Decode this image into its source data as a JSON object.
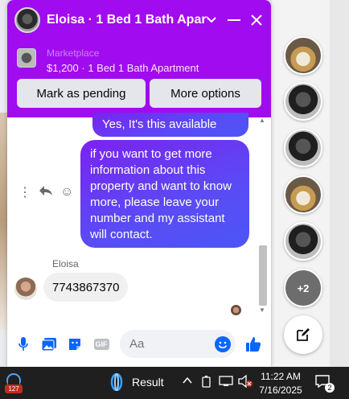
{
  "chat": {
    "title": "Eloisa · 1 Bed 1 Bath Apart",
    "marketplace_label": "Marketplace",
    "listing_title": "$1,200 · 1 Bed 1 Bath Apartment",
    "mark_pending_label": "Mark as pending",
    "more_options_label": "More options",
    "icons": {
      "chevron": "chevron-down-icon",
      "minimize": "minimize-icon",
      "close": "close-icon"
    }
  },
  "messages": {
    "outgoing_1": "Yes, It's this available now.",
    "outgoing_2": "if you want to get more information about this property and want to know more, please leave your number and my assistant will contact.",
    "sender_name": "Eloisa",
    "incoming_1": "7743867370"
  },
  "composer": {
    "placeholder": "Aa",
    "icons": [
      "mic-icon",
      "image-icon",
      "sticker-icon",
      "gif-icon",
      "emoji-icon",
      "like-icon"
    ],
    "gif_label": "GIF"
  },
  "sidebar": {
    "more_count": "+2"
  },
  "taskbar": {
    "badge": "127",
    "app_label": "Result",
    "time": "11:22 AM",
    "date": "7/16/2025",
    "notification_count": "2"
  },
  "colors": {
    "header": "#a10bf0",
    "bubble_out": "#6b35f3",
    "accent": "#0866ff"
  }
}
